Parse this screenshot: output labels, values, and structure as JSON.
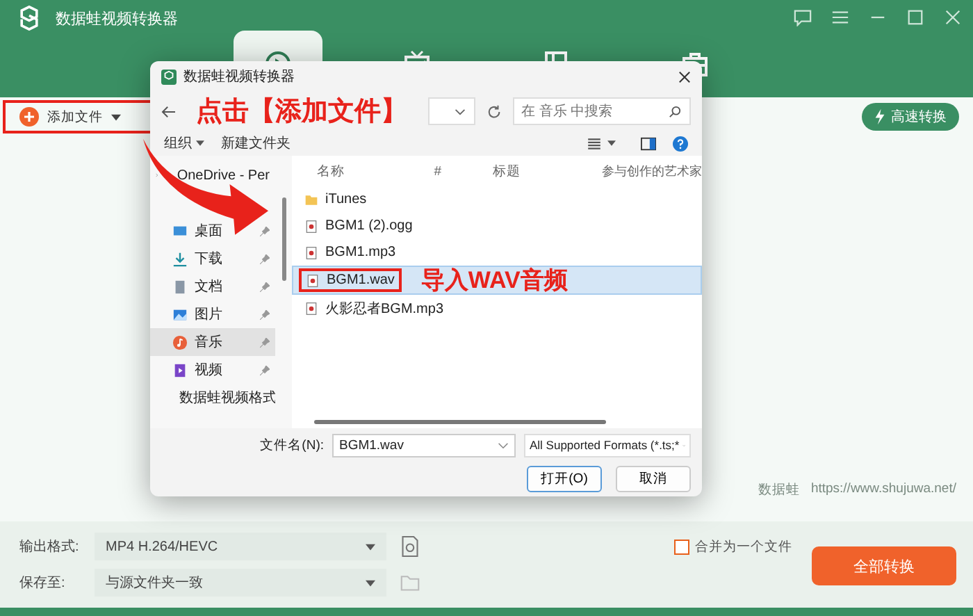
{
  "app": {
    "title": "数据蛙视频转换器"
  },
  "nav_tabs": [
    {
      "kind": "convert",
      "selected": true
    },
    {
      "kind": "media",
      "selected": false
    },
    {
      "kind": "layout",
      "selected": false
    },
    {
      "kind": "toolbox",
      "selected": false
    }
  ],
  "add_file_button": {
    "label": "添加文件"
  },
  "click_hint": "点击【添加文件】",
  "fast_convert_button": {
    "label": "高速转换"
  },
  "brand": {
    "name": "数据蛙",
    "url": "https://www.shujuwa.net/"
  },
  "dialog": {
    "title": "数据蛙视频转换器",
    "search": {
      "placeholder": "在 音乐 中搜索"
    },
    "organize_menu": "组织",
    "new_folder_button": "新建文件夹",
    "onedrive": "OneDrive - Per",
    "places": [
      {
        "label": "桌面",
        "kind": "desktop",
        "selected": false
      },
      {
        "label": "下载",
        "kind": "download",
        "selected": false
      },
      {
        "label": "文档",
        "kind": "document",
        "selected": false
      },
      {
        "label": "图片",
        "kind": "picture",
        "selected": false
      },
      {
        "label": "音乐",
        "kind": "music",
        "selected": true
      },
      {
        "label": "视频",
        "kind": "video",
        "selected": false
      },
      {
        "label": "数据蛙视频格式",
        "kind": "folder",
        "selected": false
      }
    ],
    "columns": [
      "名称",
      "#",
      "标题",
      "参与创作的艺术家"
    ],
    "files": [
      {
        "name": "iTunes",
        "kind": "folder",
        "selected": false
      },
      {
        "name": "BGM1 (2).ogg",
        "kind": "audio",
        "selected": false
      },
      {
        "name": "BGM1.mp3",
        "kind": "audio",
        "selected": false
      },
      {
        "name": "BGM1.wav",
        "kind": "audio",
        "selected": true,
        "hint": "导入WAV音频"
      },
      {
        "name": "火影忍者BGM.mp3",
        "kind": "audio",
        "selected": false
      }
    ],
    "filename_label": "文件名(N):",
    "filename": "BGM1.wav",
    "filter": "All Supported Formats (*.ts;*",
    "open_button": "打开(O)",
    "cancel_button": "取消"
  },
  "output": {
    "format_label": "输出格式:",
    "format": "MP4 H.264/HEVC",
    "save_label": "保存至:",
    "save": "与源文件夹一致"
  },
  "merge": {
    "label": "合并为一个文件",
    "checked": false
  },
  "convert_all_button": {
    "label": "全部转换"
  }
}
